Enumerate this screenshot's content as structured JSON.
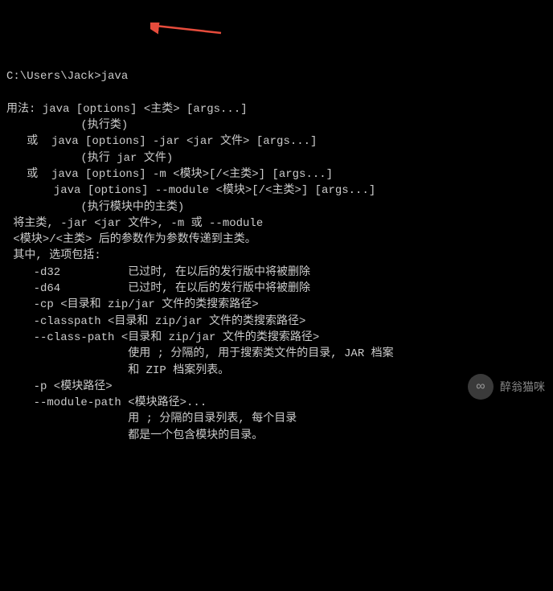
{
  "prompt": "C:\\Users\\Jack>java",
  "lines": [
    "用法: java [options] <主类> [args...]",
    "           (执行类)",
    "   或  java [options] -jar <jar 文件> [args...]",
    "           (执行 jar 文件)",
    "   或  java [options] -m <模块>[/<主类>] [args...]",
    "       java [options] --module <模块>[/<主类>] [args...]",
    "           (执行模块中的主类)",
    "",
    " 将主类, -jar <jar 文件>, -m 或 --module",
    " <模块>/<主类> 后的参数作为参数传递到主类。",
    "",
    " 其中, 选项包括:",
    "",
    "    -d32          已过时, 在以后的发行版中将被删除",
    "    -d64          已过时, 在以后的发行版中将被删除",
    "    -cp <目录和 zip/jar 文件的类搜索路径>",
    "    -classpath <目录和 zip/jar 文件的类搜索路径>",
    "    --class-path <目录和 zip/jar 文件的类搜索路径>",
    "                  使用 ; 分隔的, 用于搜索类文件的目录, JAR 档案",
    "                  和 ZIP 档案列表。",
    "    -p <模块路径>",
    "    --module-path <模块路径>...",
    "                  用 ; 分隔的目录列表, 每个目录",
    "                  都是一个包含模块的目录。"
  ],
  "watermark": {
    "text": "醉翁猫咪",
    "icon_glyph": "∞"
  },
  "arrow_color": "#e74c3c"
}
